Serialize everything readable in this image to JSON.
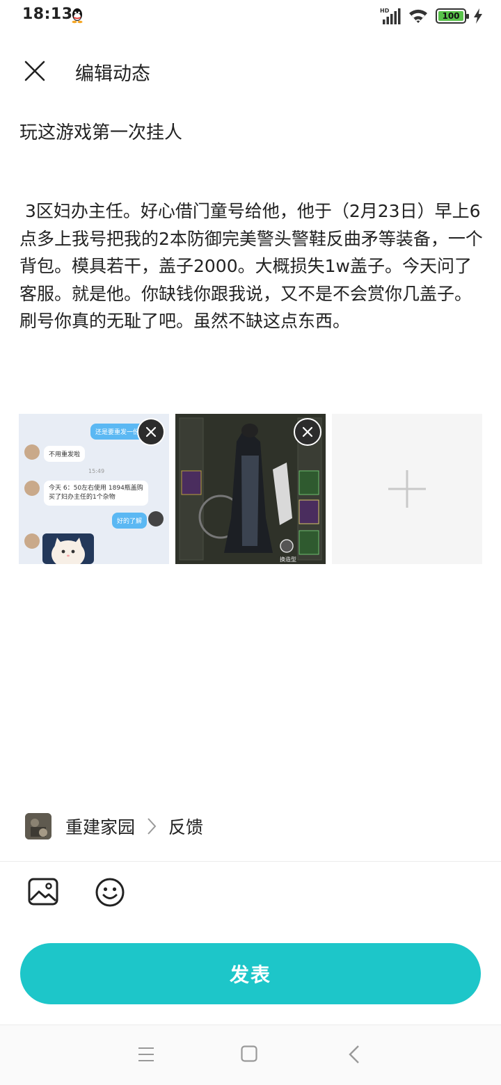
{
  "status_bar": {
    "time": "18:13",
    "network": "HD",
    "battery_level": "100",
    "icons": [
      "qq-icon",
      "signal-icon",
      "wifi-icon",
      "battery-icon",
      "charging-icon"
    ]
  },
  "header": {
    "title": "编辑动态",
    "close_icon": "close-icon"
  },
  "post": {
    "title": "玩这游戏第一次挂人",
    "body": " 3区妇办主任。好心借门童号给他，他于（2月23日）早上6点多上我号把我的2本防御完美警头警鞋反曲矛等装备，一个背包。模具若干，盖子2000。大概损失1w盖子。今天问了客服。就是他。你缺钱你跟我说，又不是不会赏你几盖子。刷号你真的无耻了吧。虽然不缺这点东西。"
  },
  "attachments": {
    "screenshot_chat": {
      "msg_1": "还是要重发一份",
      "msg_2": "不用重发啦",
      "time": "15:49",
      "msg_3_line1": "今天 6：50左右使用 1894瓶盖购",
      "msg_3_line2": "买了妇办主任的1个杂物",
      "msg_4": "好的了解"
    },
    "screenshot_game": {
      "button_label": "换造型"
    },
    "add_icon": "plus-icon",
    "remove_icon": "remove-icon"
  },
  "topic": {
    "game": "重建家园",
    "section": "反馈"
  },
  "toolbar": {
    "image_icon": "image-icon",
    "emoji_icon": "emoji-icon"
  },
  "publish": {
    "label": "发表",
    "color": "#1dc6c9"
  },
  "nav": {
    "icons": [
      "menu-icon",
      "home-icon",
      "back-icon"
    ]
  }
}
